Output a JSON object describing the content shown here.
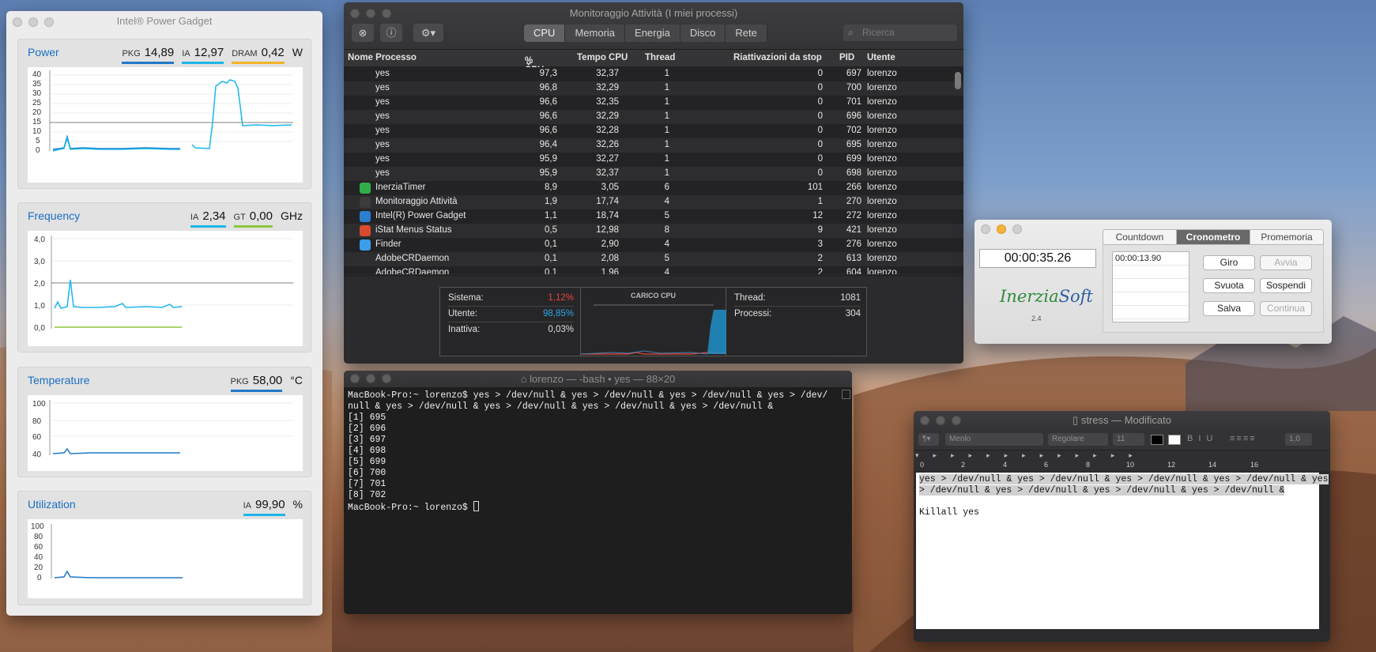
{
  "power_gadget": {
    "window_title": "Intel® Power Gadget",
    "power": {
      "title": "Power",
      "metrics": [
        {
          "label": "PKG",
          "value": "14,89",
          "color": "#1f78c8"
        },
        {
          "label": "IA",
          "value": "12,97",
          "color": "#1cb6ea"
        },
        {
          "label": "DRAM",
          "value": "0,42",
          "color": "#f4b32b"
        }
      ],
      "unit": "W",
      "yticks": [
        "40",
        "35",
        "30",
        "25",
        "20",
        "15",
        "10",
        "5",
        "0"
      ]
    },
    "frequency": {
      "title": "Frequency",
      "metrics": [
        {
          "label": "IA",
          "value": "2,34",
          "color": "#1cb6ea"
        },
        {
          "label": "GT",
          "value": "0,00",
          "color": "#8dc63f"
        }
      ],
      "unit": "GHz",
      "yticks": [
        "4,0",
        "3,0",
        "2,0",
        "1,0",
        "0,0"
      ]
    },
    "temperature": {
      "title": "Temperature",
      "metrics": [
        {
          "label": "PKG",
          "value": "58,00",
          "color": "#1f78c8"
        }
      ],
      "unit": "°C",
      "yticks": [
        "100",
        "80",
        "60",
        "40"
      ]
    },
    "utilization": {
      "title": "Utilization",
      "metrics": [
        {
          "label": "IA",
          "value": "99,90",
          "color": "#1cb6ea"
        }
      ],
      "unit": "%",
      "yticks": [
        "100",
        "80",
        "60",
        "40",
        "20",
        "0"
      ]
    }
  },
  "activity_monitor": {
    "window_title": "Monitoraggio Attività (I miei processi)",
    "tabs": [
      "CPU",
      "Memoria",
      "Energia",
      "Disco",
      "Rete"
    ],
    "active_tab": "CPU",
    "search_placeholder": "Ricerca",
    "columns": [
      "Nome Processo",
      "% CPU",
      "Tempo CPU",
      "Thread",
      "Riattivazioni da stop",
      "PID",
      "Utente"
    ],
    "rows": [
      {
        "name": "yes",
        "cpu": "97,3",
        "time": "32,37",
        "threads": "1",
        "wakeups": "0",
        "pid": "697",
        "user": "lorenzo",
        "icon": ""
      },
      {
        "name": "yes",
        "cpu": "96,8",
        "time": "32,29",
        "threads": "1",
        "wakeups": "0",
        "pid": "700",
        "user": "lorenzo",
        "icon": ""
      },
      {
        "name": "yes",
        "cpu": "96,6",
        "time": "32,35",
        "threads": "1",
        "wakeups": "0",
        "pid": "701",
        "user": "lorenzo",
        "icon": ""
      },
      {
        "name": "yes",
        "cpu": "96,6",
        "time": "32,29",
        "threads": "1",
        "wakeups": "0",
        "pid": "696",
        "user": "lorenzo",
        "icon": ""
      },
      {
        "name": "yes",
        "cpu": "96,6",
        "time": "32,28",
        "threads": "1",
        "wakeups": "0",
        "pid": "702",
        "user": "lorenzo",
        "icon": ""
      },
      {
        "name": "yes",
        "cpu": "96,4",
        "time": "32,26",
        "threads": "1",
        "wakeups": "0",
        "pid": "695",
        "user": "lorenzo",
        "icon": ""
      },
      {
        "name": "yes",
        "cpu": "95,9",
        "time": "32,27",
        "threads": "1",
        "wakeups": "0",
        "pid": "699",
        "user": "lorenzo",
        "icon": ""
      },
      {
        "name": "yes",
        "cpu": "95,9",
        "time": "32,37",
        "threads": "1",
        "wakeups": "0",
        "pid": "698",
        "user": "lorenzo",
        "icon": ""
      },
      {
        "name": "InerziaTimer",
        "cpu": "8,9",
        "time": "3,05",
        "threads": "6",
        "wakeups": "101",
        "pid": "266",
        "user": "lorenzo",
        "icon": "inerzia-timer-icon"
      },
      {
        "name": "Monitoraggio Attività",
        "cpu": "1,9",
        "time": "17,74",
        "threads": "4",
        "wakeups": "1",
        "pid": "270",
        "user": "lorenzo",
        "icon": "activity-monitor-icon"
      },
      {
        "name": "Intel(R) Power Gadget",
        "cpu": "1,1",
        "time": "18,74",
        "threads": "5",
        "wakeups": "12",
        "pid": "272",
        "user": "lorenzo",
        "icon": "power-gadget-icon"
      },
      {
        "name": "iStat Menus Status",
        "cpu": "0,5",
        "time": "12,98",
        "threads": "8",
        "wakeups": "9",
        "pid": "421",
        "user": "lorenzo",
        "icon": "istat-icon"
      },
      {
        "name": "Finder",
        "cpu": "0,1",
        "time": "2,90",
        "threads": "4",
        "wakeups": "3",
        "pid": "276",
        "user": "lorenzo",
        "icon": "finder-icon"
      },
      {
        "name": "AdobeCRDaemon",
        "cpu": "0,1",
        "time": "2,08",
        "threads": "5",
        "wakeups": "2",
        "pid": "613",
        "user": "lorenzo",
        "icon": ""
      },
      {
        "name": "AdobeCRDaemon",
        "cpu": "0,1",
        "time": "1,96",
        "threads": "4",
        "wakeups": "2",
        "pid": "604",
        "user": "lorenzo",
        "icon": ""
      }
    ],
    "summary": {
      "sistema_label": "Sistema:",
      "sistema_value": "1,12%",
      "utente_label": "Utente:",
      "utente_value": "98,85%",
      "inattiva_label": "Inattiva:",
      "inattiva_value": "0,03%",
      "chart_title": "CARICO CPU",
      "thread_label": "Thread:",
      "thread_value": "1081",
      "processi_label": "Processi:",
      "processi_value": "304",
      "colors": {
        "system": "#e8453c",
        "user": "#2aa8e8"
      }
    }
  },
  "terminal": {
    "window_title": "lorenzo — -bash • yes — 88×20",
    "lines": [
      "MacBook-Pro:~ lorenzo$ yes > /dev/null & yes > /dev/null & yes > /dev/null & yes > /dev/",
      "null & yes > /dev/null & yes > /dev/null & yes > /dev/null & yes > /dev/null &",
      "[1] 695",
      "[2] 696",
      "[3] 697",
      "[4] 698",
      "[5] 699",
      "[6] 700",
      "[7] 701",
      "[8] 702"
    ],
    "prompt": "MacBook-Pro:~ lorenzo$ "
  },
  "inerzia": {
    "time": "00:00:35.26",
    "tabs": [
      "Countdown",
      "Cronometro",
      "Promemoria"
    ],
    "active_tab": "Cronometro",
    "laps": [
      "00:00:13.90",
      "",
      "",
      "",
      ""
    ],
    "buttons": {
      "giro": "Giro",
      "avvia": "Avvia",
      "svuota": "Svuota",
      "sospendi": "Sospendi",
      "salva": "Salva",
      "continua": "Continua"
    },
    "logo_part1": "Inerzia",
    "logo_part2": "Soft",
    "version": "2.4"
  },
  "textedit": {
    "window_title": "stress — Modificato",
    "font": "Menlo",
    "style": "Regolare",
    "size": "11",
    "spacing": "1,0",
    "ruler_labels": [
      "0",
      "2",
      "4",
      "6",
      "8",
      "10",
      "12",
      "14",
      "16"
    ],
    "lines": [
      "yes > /dev/null & yes > /dev/null & yes > /dev/null & yes > /dev/null & yes",
      "> /dev/null & yes > /dev/null & yes > /dev/null & yes > /dev/null &",
      "",
      "Killall yes"
    ]
  }
}
